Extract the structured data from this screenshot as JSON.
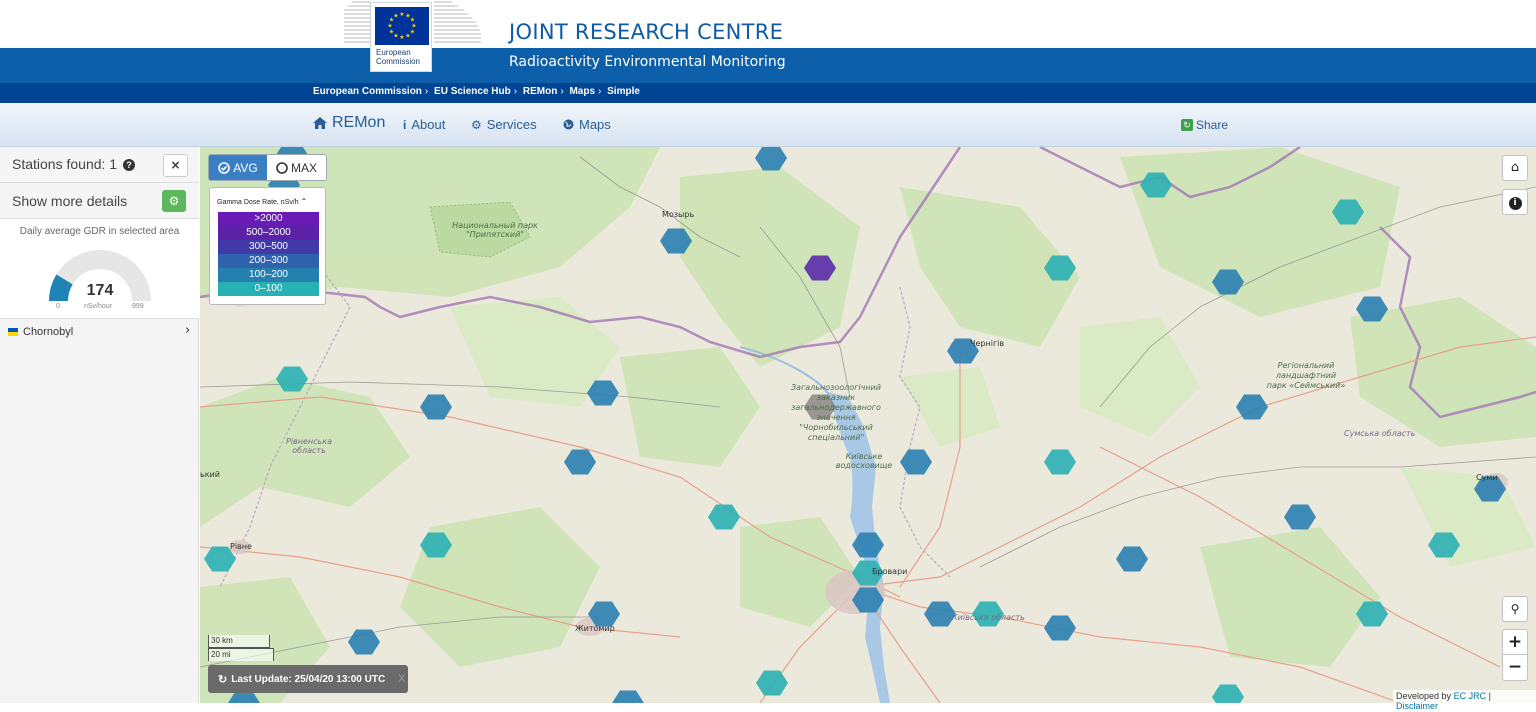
{
  "header": {
    "title": "JOINT RESEARCH CENTRE",
    "subtitle": "Radioactivity Environmental Monitoring",
    "logo_text_line1": "European",
    "logo_text_line2": "Commission",
    "brand_color": "#0c5fa8",
    "breadcrumbs": [
      "European Commission",
      "EU Science Hub",
      "REMon",
      "Maps",
      "Simple"
    ],
    "breadcrumb_sep": "›"
  },
  "nav": {
    "brand": "REMon",
    "items": [
      "About",
      "Services",
      "Maps"
    ],
    "share": "Share"
  },
  "sidebar": {
    "stations_found": "Stations found: 1",
    "show_details": "Show more details",
    "gauge": {
      "title": "Daily average GDR in selected area",
      "value": "174",
      "value_fraction": 0.174,
      "min": "0",
      "max": "999",
      "unit": "nSv/hour",
      "fill_color": "#1d84b5",
      "track_color": "#e6e6e6"
    },
    "stations": [
      {
        "name": "Chornobyl",
        "flag": "ukraine-flag-icon"
      }
    ]
  },
  "map": {
    "toggle": {
      "avg": "AVG",
      "max": "MAX",
      "selected": "AVG"
    },
    "legend": {
      "title": "Gamma Dose Rate, nSv/h",
      "items": [
        {
          "label": ">2000",
          "color": "#6a1bb5"
        },
        {
          "label": "500–2000",
          "color": "#5b22a8"
        },
        {
          "label": "300–500",
          "color": "#3f3aa8"
        },
        {
          "label": "200–300",
          "color": "#2f62ad"
        },
        {
          "label": "100–200",
          "color": "#2580b0"
        },
        {
          "label": "0–100",
          "color": "#27b0b5"
        }
      ]
    },
    "scale": {
      "km": "30 km",
      "mi": "20 mi"
    },
    "last_update": "Last Update: 25/04/20 13:00 UTC",
    "last_update_close": "X",
    "attribution": {
      "prefix": "Developed by",
      "link1": "EC JRC",
      "sep": "|",
      "link2": "Disclaimer"
    },
    "labels": [
      {
        "text": "Мозырь"
      },
      {
        "text": "Рівне"
      },
      {
        "text": "Житомир"
      },
      {
        "text": "Бровари"
      },
      {
        "text": "Київська область"
      },
      {
        "text": "Рівненська область"
      },
      {
        "text": "Сумська область"
      },
      {
        "text": "Чернігів"
      },
      {
        "text": "Суми"
      },
      {
        "text": "ький"
      }
    ],
    "park_labels": [
      "Национальный парк \"Припятский\"",
      "Загальнозоологічний заказник загальнодержавного значення \"Чорнобильський спеціальний\"",
      "Київське водосховище",
      "Регіональний ландшафтний парк «Сеймський»"
    ],
    "hex_colors": {
      "teal": "#2bb0b4",
      "blue": "#2a7fb3",
      "purple": "#5a2aa8",
      "grey": "#7c7a78"
    }
  }
}
